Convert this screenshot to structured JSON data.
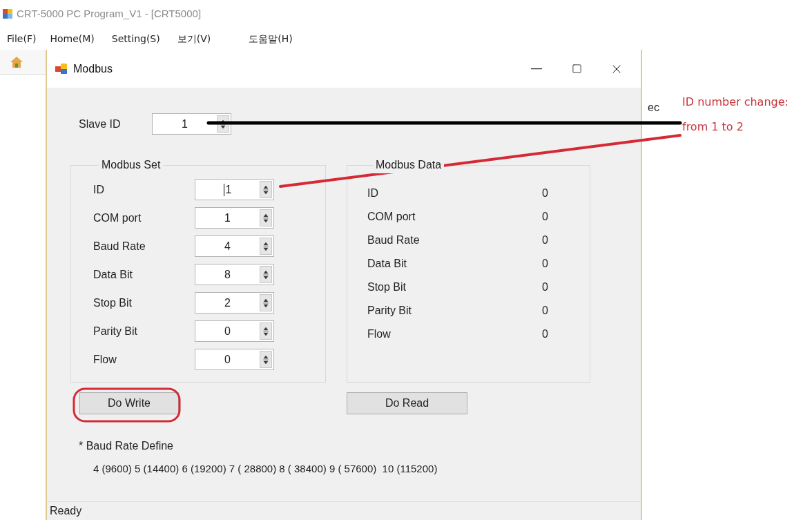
{
  "app": {
    "title": "CRT-5000 PC Program_V1 - [CRT5000]",
    "menu": [
      "File(F)",
      "Home(M)",
      "Setting(S)",
      "보기(V)",
      "도움말(H)"
    ],
    "background_fragment": "ec",
    "status": "Ready"
  },
  "dialog": {
    "title": "Modbus",
    "slave_id": {
      "label": "Slave ID",
      "value": "1"
    },
    "modbus_set": {
      "title": "Modbus Set",
      "rows": [
        {
          "label": "ID",
          "value": "1",
          "focused": true
        },
        {
          "label": "COM port",
          "value": "1",
          "focused": false
        },
        {
          "label": "Baud Rate",
          "value": "4",
          "focused": false
        },
        {
          "label": "Data Bit",
          "value": "8",
          "focused": false
        },
        {
          "label": "Stop Bit",
          "value": "2",
          "focused": false
        },
        {
          "label": "Parity Bit",
          "value": "0",
          "focused": false
        },
        {
          "label": "Flow",
          "value": "0",
          "focused": false
        }
      ]
    },
    "modbus_data": {
      "title": "Modbus Data",
      "rows": [
        {
          "label": "ID",
          "value": "0"
        },
        {
          "label": "COM port",
          "value": "0"
        },
        {
          "label": "Baud Rate",
          "value": "0"
        },
        {
          "label": "Data Bit",
          "value": "0"
        },
        {
          "label": "Stop Bit",
          "value": "0"
        },
        {
          "label": "Parity Bit",
          "value": "0"
        },
        {
          "label": "Flow",
          "value": "0"
        }
      ]
    },
    "write_button": "Do Write",
    "read_button": "Do Read",
    "baud_note": {
      "title": "* Baud Rate Define",
      "text": "4 (9600) 5 (14400) 6 (19200) 7 ( 28800) 8 ( 38400) 9 ( 57600)  10 (115200)"
    }
  },
  "annotation": {
    "lines": [
      "ID number change:",
      "from 1 to 2"
    ]
  }
}
